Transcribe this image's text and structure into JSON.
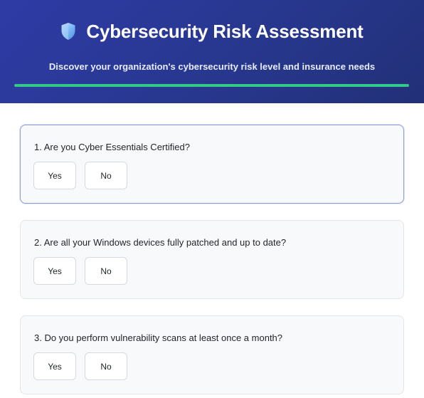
{
  "header": {
    "title": "Cybersecurity Risk Assessment",
    "subtitle": "Discover your organization's cybersecurity risk level and insurance needs",
    "icon": "shield-icon",
    "accent_color": "#34c88a",
    "background_color": "#2a3696"
  },
  "questions": [
    {
      "text": "1. Are you Cyber Essentials Certified?",
      "yes_label": "Yes",
      "no_label": "No"
    },
    {
      "text": "2. Are all your Windows devices fully patched and up to date?",
      "yes_label": "Yes",
      "no_label": "No"
    },
    {
      "text": "3. Do you perform vulnerability scans at least once a month?",
      "yes_label": "Yes",
      "no_label": "No"
    }
  ]
}
